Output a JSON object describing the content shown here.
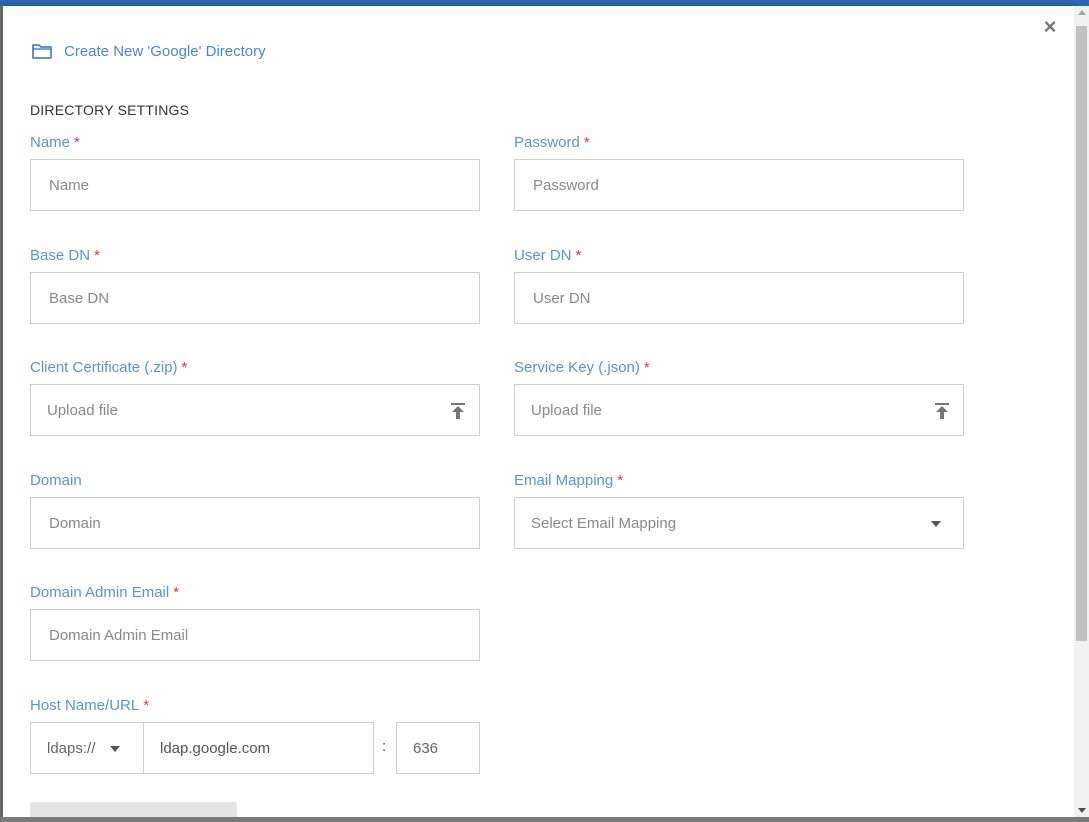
{
  "header": {
    "title": "Create New 'Google' Directory",
    "folder_icon": "folder-icon",
    "close_icon": "close-icon",
    "close_label": "×"
  },
  "section": {
    "title": "DIRECTORY SETTINGS"
  },
  "required_marker": "*",
  "fields": {
    "name": {
      "label": "Name",
      "placeholder": "Name"
    },
    "password": {
      "label": "Password",
      "placeholder": "Password"
    },
    "base_dn": {
      "label": "Base DN",
      "placeholder": "Base DN"
    },
    "user_dn": {
      "label": "User DN",
      "placeholder": "User DN"
    },
    "client_certificate": {
      "label": "Client Certificate (.zip)",
      "placeholder": "Upload file"
    },
    "service_key": {
      "label": "Service Key (.json)",
      "placeholder": "Upload file"
    },
    "domain": {
      "label": "Domain",
      "placeholder": "Domain"
    },
    "email_mapping": {
      "label": "Email Mapping",
      "placeholder": "Select Email Mapping"
    },
    "domain_admin_email": {
      "label": "Domain Admin Email",
      "placeholder": "Domain Admin Email"
    },
    "host": {
      "label": "Host Name/URL",
      "protocol": "ldaps://",
      "hostname": "ldap.google.com",
      "separator": ":",
      "port": "636"
    }
  },
  "colors": {
    "accent": "#4a86d4",
    "label": "#5b93d6",
    "required": "#e03a3a",
    "top_bar": "#2a64b4"
  }
}
